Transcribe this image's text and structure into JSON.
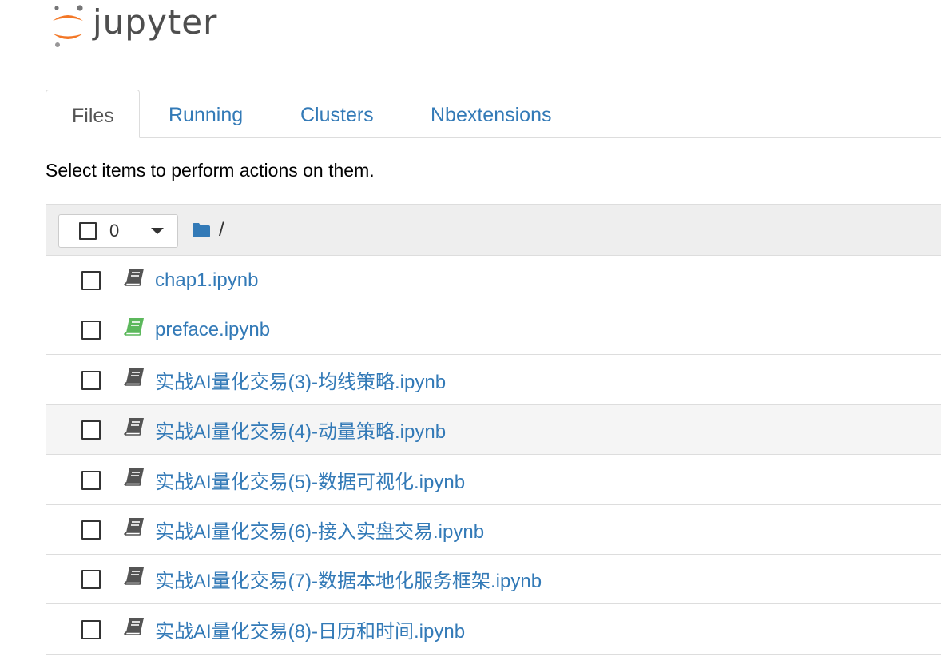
{
  "header": {
    "logo_text": "jupyter",
    "logo_colors": {
      "orange": "#f37726",
      "gray": "#767677"
    }
  },
  "tabs": [
    {
      "label": "Files",
      "active": true
    },
    {
      "label": "Running",
      "active": false
    },
    {
      "label": "Clusters",
      "active": false
    },
    {
      "label": "Nbextensions",
      "active": false
    }
  ],
  "instructions": "Select items to perform actions on them.",
  "toolbar": {
    "selected_count": "0",
    "breadcrumb": "/",
    "folder_icon": "folder-icon",
    "dropdown_icon": "caret-down-icon"
  },
  "files": [
    {
      "name": "chap1.ipynb",
      "running": false,
      "icon": "notebook-icon"
    },
    {
      "name": "preface.ipynb",
      "running": true,
      "icon": "notebook-icon"
    },
    {
      "name": "实战AI量化交易(3)-均线策略.ipynb",
      "running": false,
      "icon": "notebook-icon"
    },
    {
      "name": "实战AI量化交易(4)-动量策略.ipynb",
      "running": false,
      "icon": "notebook-icon"
    },
    {
      "name": "实战AI量化交易(5)-数据可视化.ipynb",
      "running": false,
      "icon": "notebook-icon"
    },
    {
      "name": "实战AI量化交易(6)-接入实盘交易.ipynb",
      "running": false,
      "icon": "notebook-icon"
    },
    {
      "name": "实战AI量化交易(7)-数据本地化服务框架.ipynb",
      "running": false,
      "icon": "notebook-icon"
    },
    {
      "name": "实战AI量化交易(8)-日历和时间.ipynb",
      "running": false,
      "icon": "notebook-icon"
    }
  ],
  "colors": {
    "link": "#337ab7",
    "running_icon": "#5cb85c",
    "idle_icon": "#555555",
    "header_bg": "#eeeeee",
    "border": "#dddddd"
  }
}
